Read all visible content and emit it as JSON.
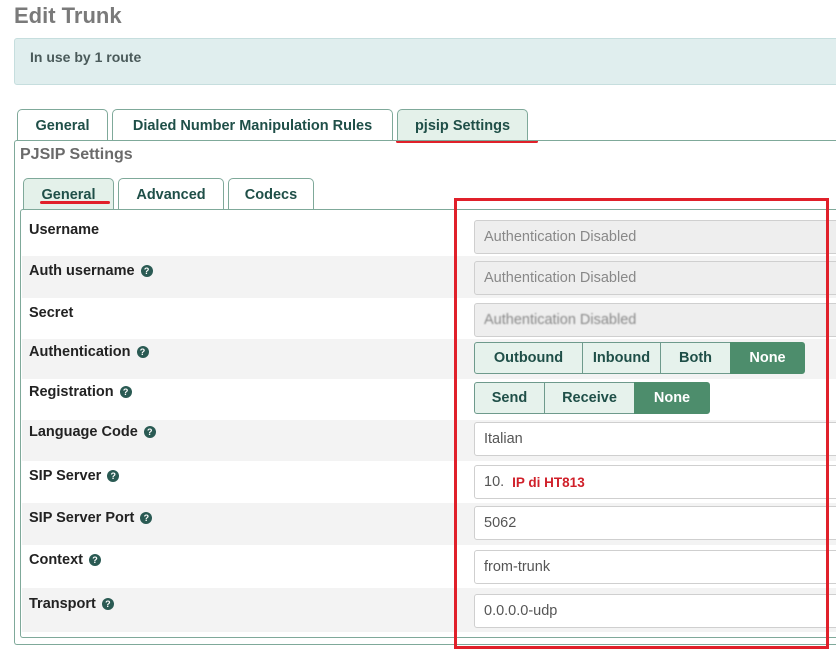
{
  "page": {
    "title": "Edit Trunk"
  },
  "info": {
    "text": "In use by 1 route"
  },
  "top_tabs": [
    {
      "label": "General"
    },
    {
      "label": "Dialed Number Manipulation Rules"
    },
    {
      "label": "pjsip Settings"
    }
  ],
  "section": {
    "title": "PJSIP Settings"
  },
  "sub_tabs": [
    {
      "label": "General"
    },
    {
      "label": "Advanced"
    },
    {
      "label": "Codecs"
    }
  ],
  "form": {
    "username": {
      "label": "Username",
      "value": "Authentication Disabled"
    },
    "auth_username": {
      "label": "Auth username",
      "value": "Authentication Disabled"
    },
    "secret": {
      "label": "Secret",
      "value": "Authentication Disabled"
    },
    "authentication": {
      "label": "Authentication",
      "options": [
        "Outbound",
        "Inbound",
        "Both",
        "None"
      ],
      "selected": "None"
    },
    "registration": {
      "label": "Registration",
      "options": [
        "Send",
        "Receive",
        "None"
      ],
      "selected": "None"
    },
    "language_code": {
      "label": "Language Code",
      "value": "Italian"
    },
    "sip_server": {
      "label": "SIP Server",
      "value": "10.",
      "annotation": "IP di HT813"
    },
    "sip_server_port": {
      "label": "SIP Server Port",
      "value": "5062"
    },
    "context": {
      "label": "Context",
      "value": "from-trunk"
    },
    "transport": {
      "label": "Transport",
      "value": "0.0.0.0-udp"
    }
  },
  "help_icon_glyph": "?",
  "colors": {
    "accent": "#4d8d6c",
    "highlight": "#e0202a",
    "tab_text": "#1f4f48"
  }
}
